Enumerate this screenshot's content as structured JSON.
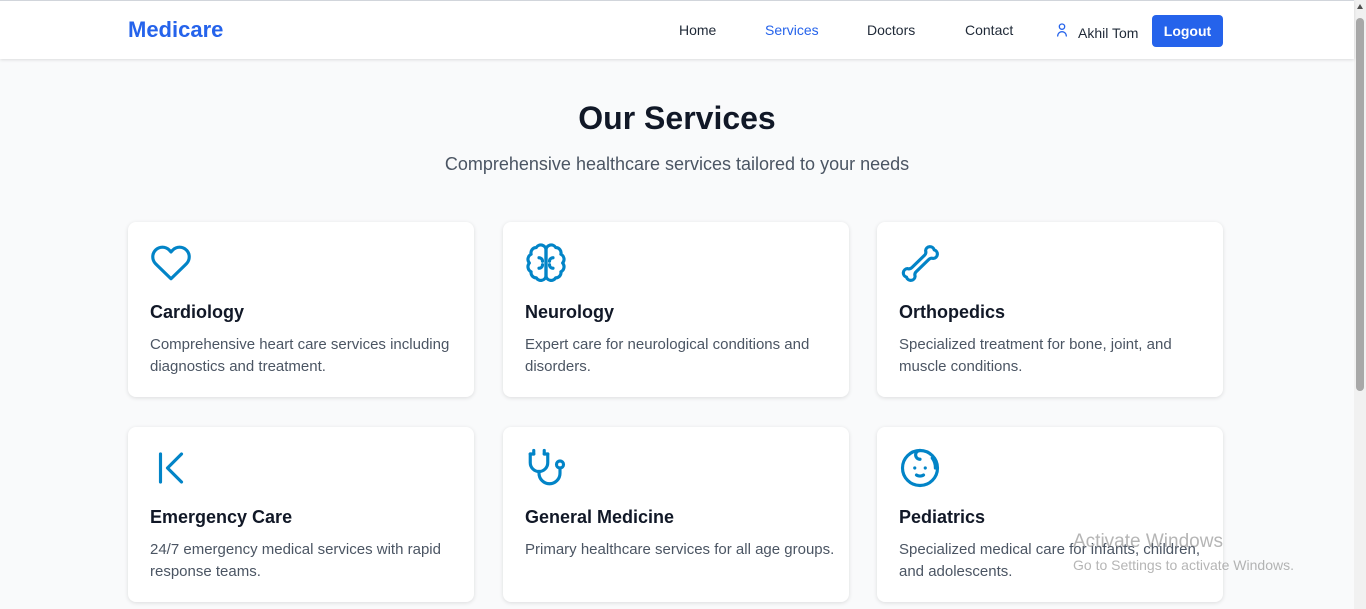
{
  "nav": {
    "brand": "Medicare",
    "links": [
      {
        "label": "Home",
        "active": false
      },
      {
        "label": "Services",
        "active": true
      },
      {
        "label": "Doctors",
        "active": false
      },
      {
        "label": "Contact",
        "active": false
      }
    ],
    "user_name": "Akhil Tom",
    "user_icon": "user-icon",
    "logout_label": "Logout"
  },
  "hero": {
    "title": "Our Services",
    "subtitle": "Comprehensive healthcare services tailored to your needs"
  },
  "services": [
    {
      "icon": "heart-icon",
      "title": "Cardiology",
      "description": "Comprehensive heart care services including diagnostics and treatment."
    },
    {
      "icon": "brain-icon",
      "title": "Neurology",
      "description": "Expert care for neurological conditions and disorders."
    },
    {
      "icon": "bone-icon",
      "title": "Orthopedics",
      "description": "Specialized treatment for bone, joint, and muscle conditions."
    },
    {
      "icon": "ambulance-icon",
      "title": "Emergency Care",
      "description": "24/7 emergency medical services with rapid response teams."
    },
    {
      "icon": "stethoscope-icon",
      "title": "General Medicine",
      "description": "Primary healthcare services for all age groups."
    },
    {
      "icon": "baby-icon",
      "title": "Pediatrics",
      "description": "Specialized medical care for infants, children, and adolescents."
    }
  ],
  "watermark": {
    "title": "Activate Windows",
    "subtitle": "Go to Settings to activate Windows."
  },
  "colors": {
    "brand": "#2563eb",
    "icon": "#0284c7",
    "background": "#f9fafb"
  }
}
